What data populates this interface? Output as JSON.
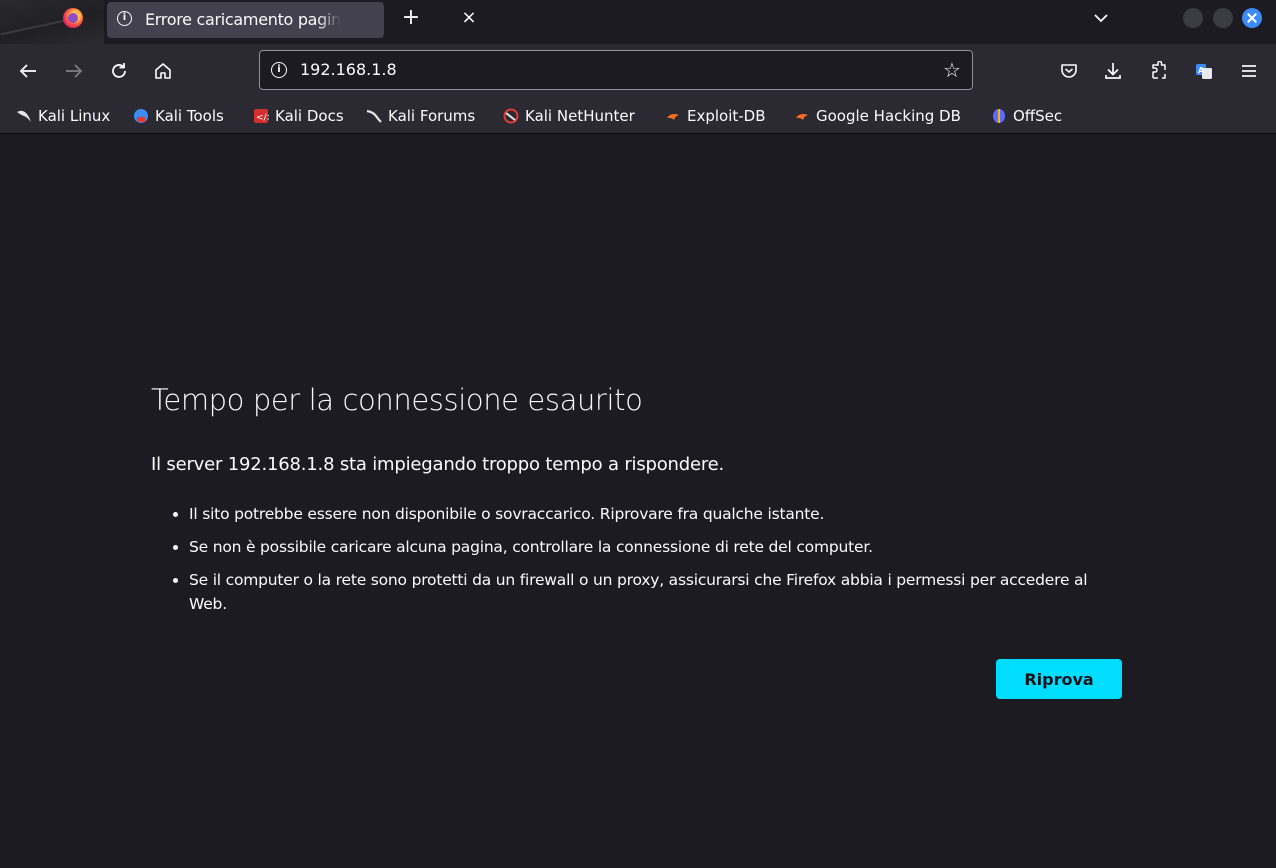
{
  "tab": {
    "title": "Errore caricamento pagina",
    "close_glyph": "×"
  },
  "tabbar": {
    "new_tab_glyph": "+"
  },
  "urlbar": {
    "url": "192.168.1.8",
    "info_glyph": "i",
    "bookmark_glyph": "☆"
  },
  "bookmarks": [
    {
      "label": "Kali Linux",
      "icon": "kali-dragon-icon",
      "color": "#e6e6e6"
    },
    {
      "label": "Kali Tools",
      "icon": "kali-tools-icon",
      "color": "#3d8cf5"
    },
    {
      "label": "Kali Docs",
      "icon": "kali-docs-icon",
      "color": "#d32f2f"
    },
    {
      "label": "Kali Forums",
      "icon": "kali-forums-icon",
      "color": "#e6e6e6"
    },
    {
      "label": "Kali NetHunter",
      "icon": "nethunter-icon",
      "color": "#e53935"
    },
    {
      "label": "Exploit-DB",
      "icon": "exploit-db-icon",
      "color": "#ff6d1f"
    },
    {
      "label": "Google Hacking DB",
      "icon": "ghdb-icon",
      "color": "#ff6d1f"
    },
    {
      "label": "OffSec",
      "icon": "offsec-icon",
      "color": "#5b6cff"
    }
  ],
  "error": {
    "title": "Tempo per la connessione esaurito",
    "description": "Il server 192.168.1.8 sta impiegando troppo tempo a rispondere.",
    "items": [
      "Il sito potrebbe essere non disponibile o sovraccarico. Riprovare fra qualche istante.",
      "Se non è possibile caricare alcuna pagina, controllare la connessione di rete del computer.",
      "Se il computer o la rete sono protetti da un firewall o un proxy, assicurarsi che Firefox abbia i permessi per accedere al Web."
    ],
    "retry_label": "Riprova"
  },
  "colors": {
    "accent": "#00ddff",
    "page_bg": "#1c1b22",
    "toolbar_bg": "#2b2a33"
  }
}
